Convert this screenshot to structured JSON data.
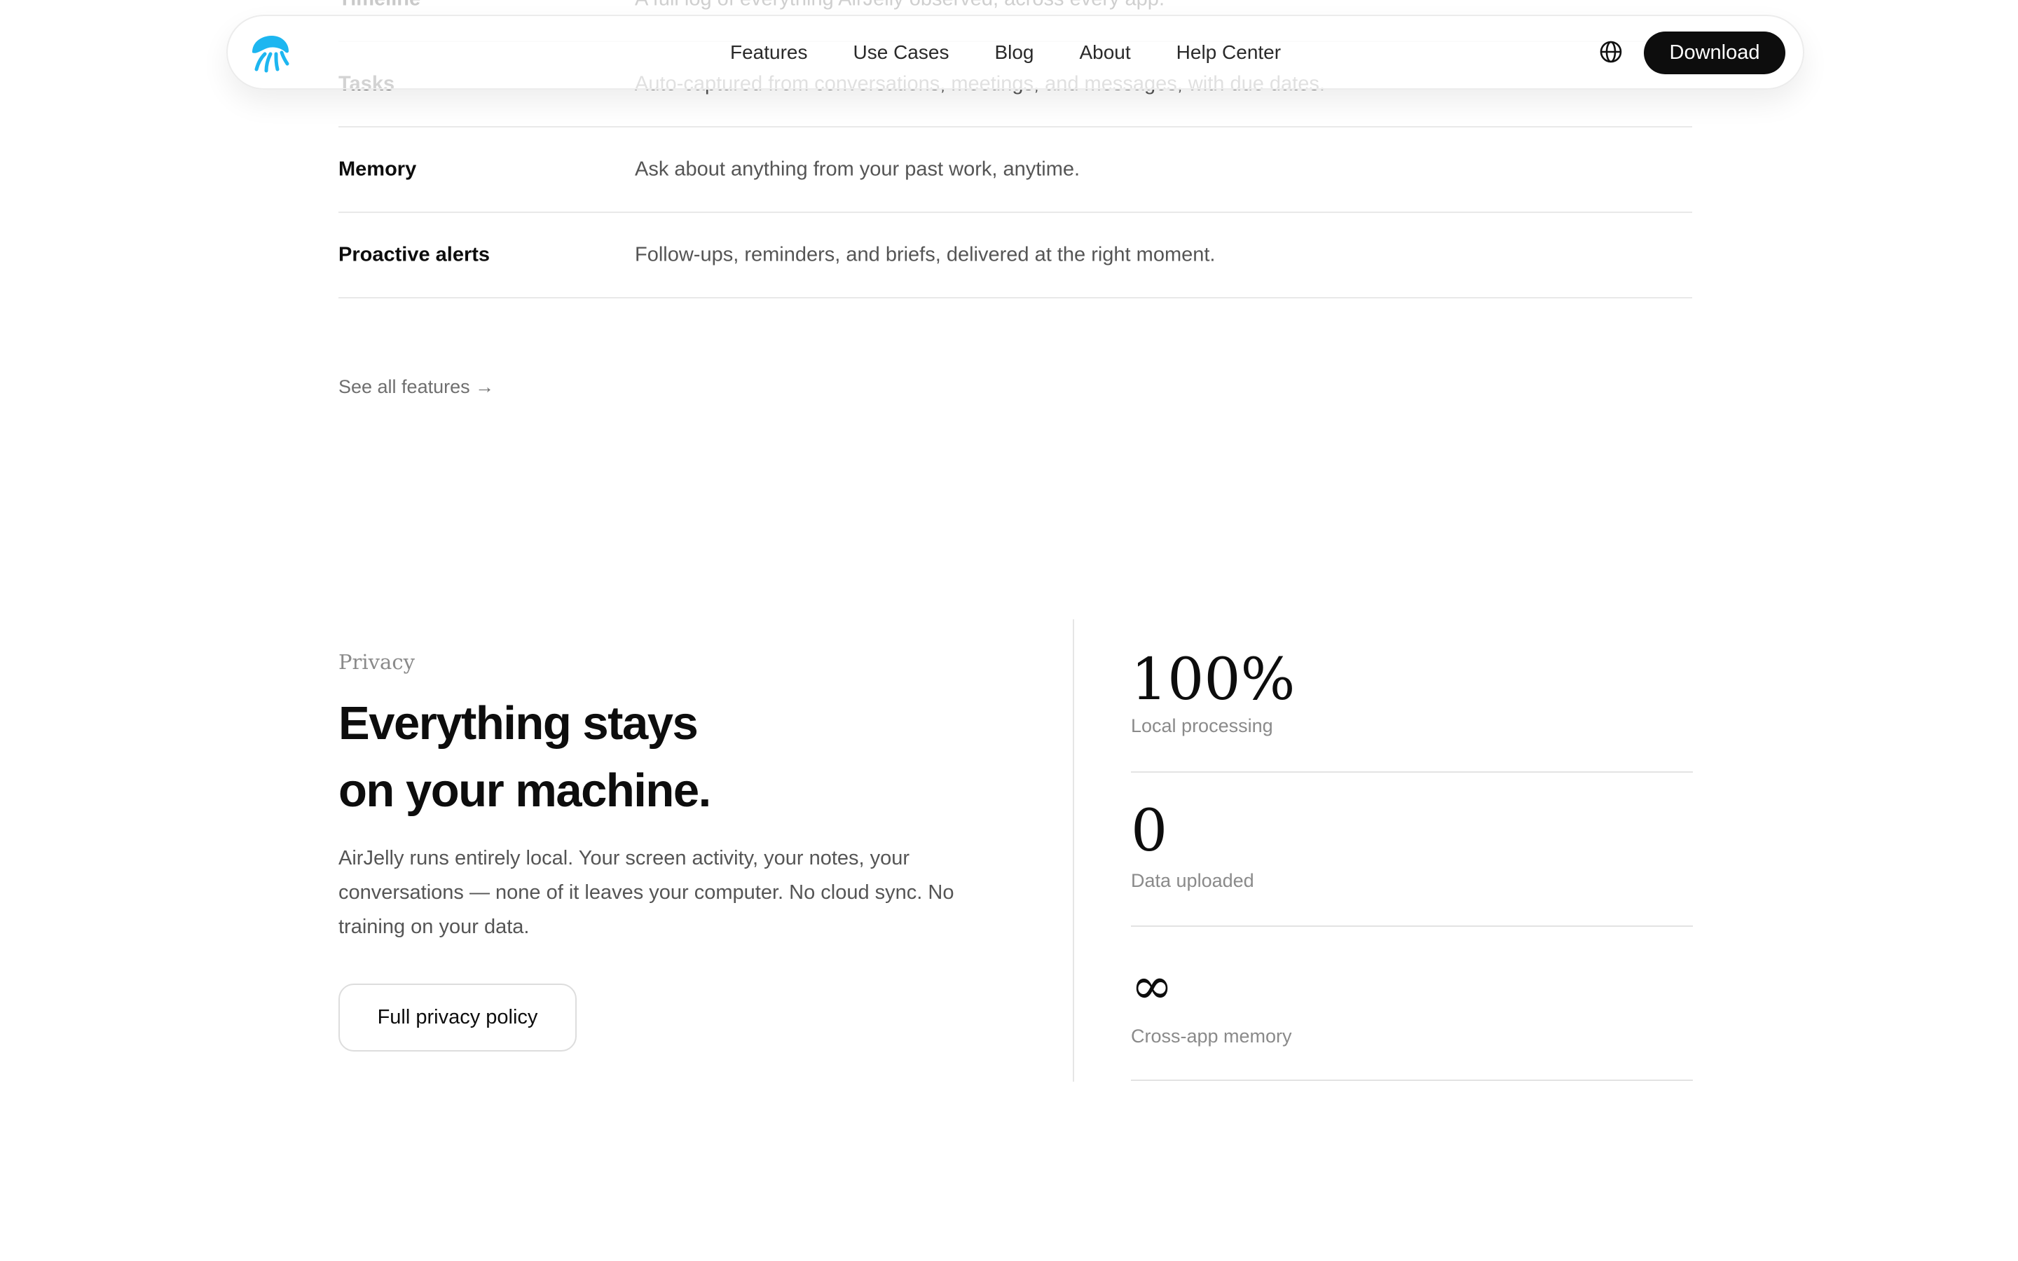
{
  "nav": {
    "links": [
      "Features",
      "Use Cases",
      "Blog",
      "About",
      "Help Center"
    ],
    "download_label": "Download",
    "brand_color": "#1db6f0"
  },
  "features": {
    "rows": [
      {
        "name": "Timeline",
        "desc": "A full log of everything AirJelly observed, across every app."
      },
      {
        "name": "Tasks",
        "desc": "Auto-captured from conversations, meetings, and messages, with due dates."
      },
      {
        "name": "Memory",
        "desc": "Ask about anything from your past work, anytime."
      },
      {
        "name": "Proactive alerts",
        "desc": "Follow-ups, reminders, and briefs, delivered at the right moment."
      }
    ],
    "see_all": "See all features →"
  },
  "privacy": {
    "eyebrow": "Privacy",
    "title_line1": "Everything stays",
    "title_line2": "on your machine.",
    "body": "AirJelly runs entirely local. Your screen activity, your notes, your conversations — none of it leaves your computer. No cloud sync. No training on your data.",
    "button": "Full privacy policy"
  },
  "stats": [
    {
      "value": "100%",
      "label": "Local processing"
    },
    {
      "value": "0",
      "label": "Data uploaded"
    },
    {
      "value": "∞",
      "label": "Cross-app memory"
    }
  ]
}
